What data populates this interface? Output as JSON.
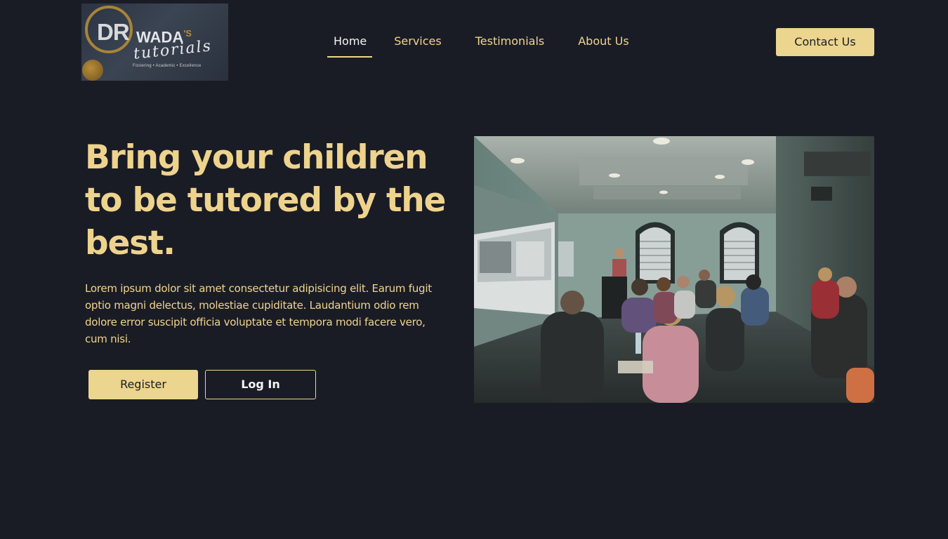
{
  "header": {
    "logo": {
      "prefix": "DR",
      "name": "WADA",
      "possessive": "'S",
      "script": "tutorials",
      "tagline": "Fostering • Academic • Excellence"
    },
    "nav": [
      {
        "label": "Home",
        "active": true
      },
      {
        "label": "Services",
        "active": false
      },
      {
        "label": "Testimonials",
        "active": false
      },
      {
        "label": "About Us",
        "active": false
      }
    ],
    "contact_label": "Contact Us"
  },
  "hero": {
    "title": "Bring your children to be tutored by the best.",
    "description": "Lorem ipsum dolor sit amet consectetur adipisicing elit. Earum fugit optio magni delectus, molestiae cupiditate. Laudantium odio rem dolore error suscipit officia voluptate et tempora modi facere vero, cum nisi.",
    "register_label": "Register",
    "login_label": "Log In"
  },
  "colors": {
    "background": "#1a1c25",
    "accent": "#ecd58f",
    "heading": "#eed38d",
    "button_text": "#1b1d25"
  }
}
